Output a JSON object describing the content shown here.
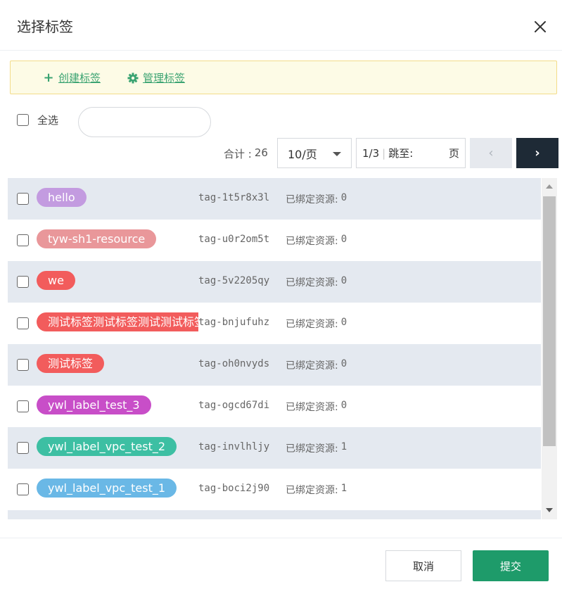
{
  "dialog": {
    "title": "选择标签"
  },
  "toolbar": {
    "create_label": "创建标签",
    "manage_label": "管理标签"
  },
  "filter": {
    "select_all_label": "全选",
    "search_value": "",
    "search_placeholder": ""
  },
  "pagination": {
    "total_label": "合计 :",
    "total_value": "26",
    "page_size": "10/页",
    "current": "1/3",
    "separator": "|",
    "jump_label": "跳至:",
    "jump_value": "",
    "page_unit": "页",
    "prev_icon": "‹",
    "next_icon": "›"
  },
  "tags": [
    {
      "name": "hello",
      "id": "tag-1t5r8x3l",
      "bound_label": "已绑定资源:",
      "bound_count": "0",
      "color": "#c39be0"
    },
    {
      "name": "tyw-sh1-resource",
      "id": "tag-u0r2om5t",
      "bound_label": "已绑定资源:",
      "bound_count": "0",
      "color": "#e9979a"
    },
    {
      "name": "we",
      "id": "tag-5v2205qy",
      "bound_label": "已绑定资源:",
      "bound_count": "0",
      "color": "#f25c5c"
    },
    {
      "name": "测试标签测试标签测试测试标签",
      "id": "tag-bnjufuhz",
      "bound_label": "已绑定资源:",
      "bound_count": "0",
      "color": "#f25c5c"
    },
    {
      "name": "测试标签",
      "id": "tag-oh0nvyds",
      "bound_label": "已绑定资源:",
      "bound_count": "0",
      "color": "#f25c5c"
    },
    {
      "name": "ywl_label_test_3",
      "id": "tag-ogcd67di",
      "bound_label": "已绑定资源:",
      "bound_count": "0",
      "color": "#c84ec8"
    },
    {
      "name": "ywl_label_vpc_test_2",
      "id": "tag-invlhljy",
      "bound_label": "已绑定资源:",
      "bound_count": "1",
      "color": "#3dbfa3"
    },
    {
      "name": "ywl_label_vpc_test_1",
      "id": "tag-boci2j90",
      "bound_label": "已绑定资源:",
      "bound_count": "1",
      "color": "#6ab8e6"
    }
  ],
  "footer": {
    "cancel_label": "取消",
    "submit_label": "提交"
  },
  "colors": {
    "accent": "#3aa371",
    "submit": "#1e9b6a",
    "next_button": "#1e2a36",
    "row_alt": "#e4e9f0",
    "toolbar_bg": "#fdfbe6"
  }
}
